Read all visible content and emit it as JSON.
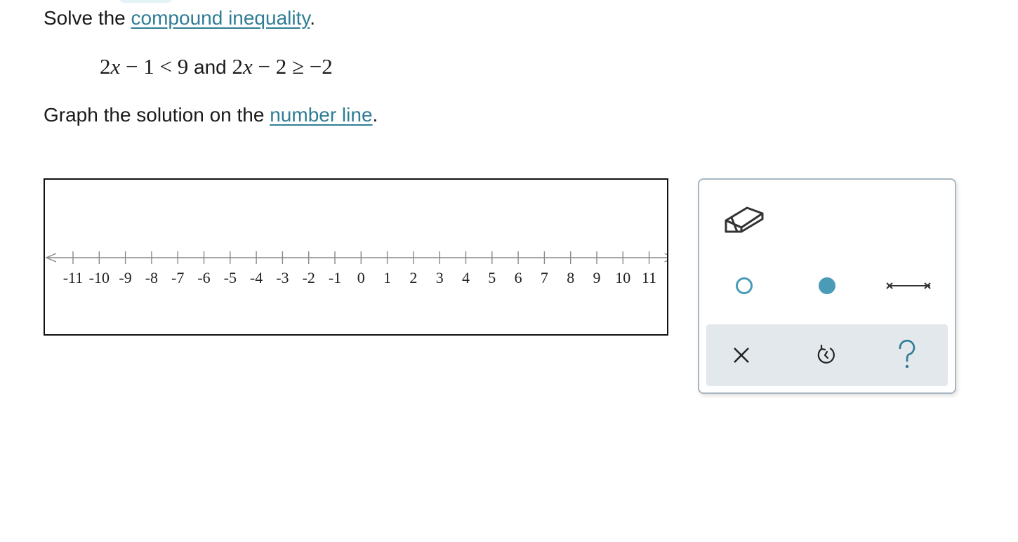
{
  "instructions": {
    "solve_prefix": "Solve the ",
    "solve_term": "compound inequality",
    "solve_suffix": ".",
    "graph_prefix": "Graph the solution on the ",
    "graph_term": "number line",
    "graph_suffix": "."
  },
  "inequality": {
    "left": {
      "coef": "2",
      "var": "x",
      "rest": " − 1 < 9"
    },
    "conjunction": " and ",
    "right": {
      "coef": "2",
      "var": "x",
      "rest": " − 2 ≥ −2"
    }
  },
  "number_line": {
    "min": -11,
    "max": 11,
    "tick_labels": [
      "-11",
      "-10",
      "-9",
      "-8",
      "-7",
      "-6",
      "-5",
      "-4",
      "-3",
      "-2",
      "-1",
      "0",
      "1",
      "2",
      "3",
      "4",
      "5",
      "6",
      "7",
      "8",
      "9",
      "10",
      "11"
    ]
  },
  "tools": {
    "eraser": "eraser-icon",
    "open_point": "open-circle-icon",
    "closed_point": "closed-circle-icon",
    "segment": "segment-icon",
    "clear": "close-icon",
    "undo": "undo-icon",
    "help": "help-icon"
  },
  "colors": {
    "link": "#2f7d94",
    "accent": "#4a9bb8",
    "panel_border": "#a9b6c0",
    "toolbar_bg": "#e3e8ec"
  }
}
